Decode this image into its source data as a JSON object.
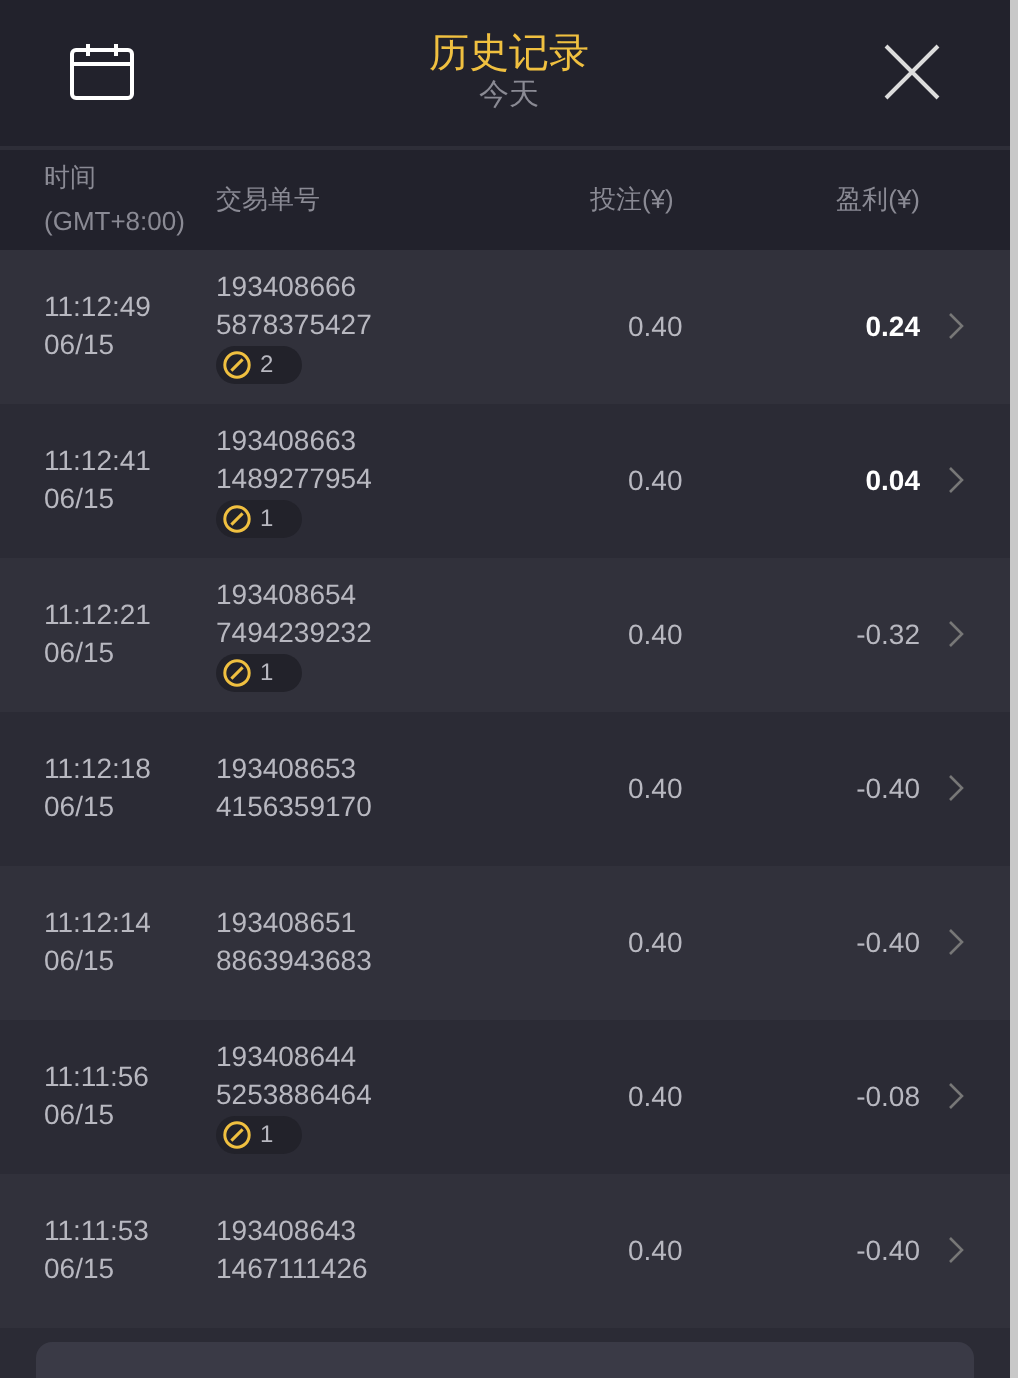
{
  "header": {
    "title": "历史记录",
    "subtitle": "今天"
  },
  "columns": [
    "时间",
    "(GMT+8:00)",
    "交易单号",
    "投注(¥)",
    "盈利(¥)"
  ],
  "rows": [
    {
      "time": "11:12:49",
      "date": "06/15",
      "order": "193408666",
      "order_2": "5878375427",
      "badge": "2",
      "stake": "0.40",
      "profit": "0.24",
      "highlight": true
    },
    {
      "time": "11:12:41",
      "date": "06/15",
      "order": "193408663",
      "order_2": "1489277954",
      "badge": "1",
      "stake": "0.40",
      "profit": "0.04",
      "highlight": true
    },
    {
      "time": "11:12:21",
      "date": "06/15",
      "order": "193408654",
      "order_2": "7494239232",
      "badge": "1",
      "stake": "0.40",
      "profit": "-0.32",
      "highlight": false
    },
    {
      "time": "11:12:18",
      "date": "06/15",
      "order": "193408653",
      "order_2": "4156359170",
      "stake": "0.40",
      "profit": "-0.40",
      "highlight": false
    },
    {
      "time": "11:12:14",
      "date": "06/15",
      "order": "193408651",
      "order_2": "8863943683",
      "stake": "0.40",
      "profit": "-0.40",
      "highlight": false
    },
    {
      "time": "11:11:56",
      "date": "06/15",
      "order": "193408644",
      "order_2": "5253886464",
      "badge": "1",
      "stake": "0.40",
      "profit": "-0.08",
      "highlight": false
    },
    {
      "time": "11:11:53",
      "date": "06/15",
      "order": "193408643",
      "order_2": "1467111426",
      "stake": "0.40",
      "profit": "-0.40",
      "highlight": false
    }
  ]
}
